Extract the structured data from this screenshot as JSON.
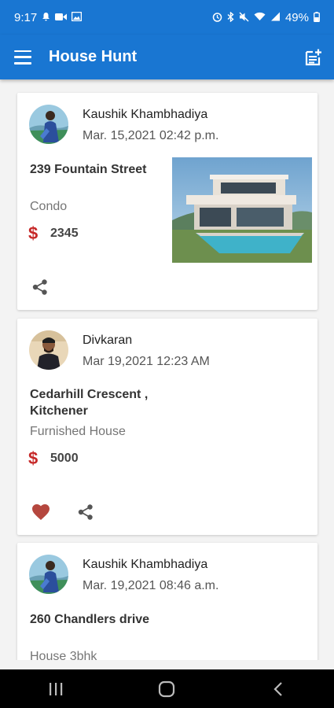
{
  "status_bar": {
    "time": "9:17",
    "battery": "49%",
    "left_icons": [
      "notification-icon",
      "video-icon",
      "image-icon"
    ],
    "right_icons": [
      "alarm-icon",
      "bluetooth-icon",
      "mute-icon",
      "wifi-icon",
      "signal-icon",
      "battery-icon"
    ]
  },
  "app_bar": {
    "title": "House Hunt",
    "menu_icon": "hamburger-menu-icon",
    "action_icon": "add-post-icon",
    "color": "#1976d2"
  },
  "posts": [
    {
      "author": "Kaushik Khambhadiya",
      "date": "Mar. 15,2021 02:42 p.m.",
      "address": "239 Fountain Street",
      "type": "Condo",
      "price": "2345",
      "currency_symbol": "$",
      "has_photo": true,
      "liked": false
    },
    {
      "author": "Divkaran",
      "date": "Mar 19,2021 12:23 AM",
      "address": "Cedarhill Crescent , Kitchener",
      "type": "Furnished House",
      "price": "5000",
      "currency_symbol": "$",
      "has_photo": false,
      "liked": true
    },
    {
      "author": "Kaushik Khambhadiya",
      "date": "Mar. 19,2021 08:46 a.m.",
      "address": "260 Chandlers drive",
      "type": "House 3bhk",
      "has_photo": false
    }
  ],
  "colors": {
    "primary": "#1976d2",
    "price_symbol": "#c62828",
    "like": "#b5473e"
  },
  "nav_bar": {
    "buttons": [
      "recent-apps-icon",
      "home-icon",
      "back-icon"
    ]
  }
}
